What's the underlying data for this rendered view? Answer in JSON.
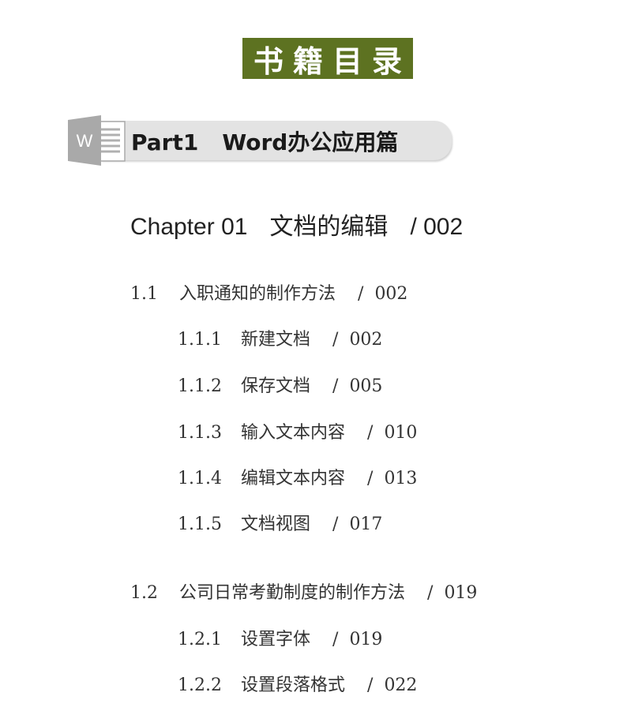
{
  "title": "书籍目录",
  "part": {
    "icon": "word-icon",
    "icon_letter": "W",
    "label": "Part1",
    "name": "Word办公应用篇"
  },
  "chapter": {
    "label": "Chapter 01",
    "title": "文档的编辑",
    "separator": "/",
    "page": "002"
  },
  "sections": [
    {
      "num": "1.1",
      "title": "入职通知的制作方法",
      "separator": "/",
      "page": "002",
      "subsections": [
        {
          "num": "1.1.1",
          "title": "新建文档",
          "separator": "/",
          "page": "002"
        },
        {
          "num": "1.1.2",
          "title": "保存文档",
          "separator": "/",
          "page": "005"
        },
        {
          "num": "1.1.3",
          "title": "输入文本内容",
          "separator": "/",
          "page": "010"
        },
        {
          "num": "1.1.4",
          "title": "编辑文本内容",
          "separator": "/",
          "page": "013"
        },
        {
          "num": "1.1.5",
          "title": "文档视图",
          "separator": "/",
          "page": "017"
        }
      ]
    },
    {
      "num": "1.2",
      "title": "公司日常考勤制度的制作方法",
      "separator": "/",
      "page": "019",
      "subsections": [
        {
          "num": "1.2.1",
          "title": "设置字体",
          "separator": "/",
          "page": "019"
        },
        {
          "num": "1.2.2",
          "title": "设置段落格式",
          "separator": "/",
          "page": "022"
        }
      ]
    }
  ],
  "colors": {
    "banner_green": "#5d7221",
    "pill_gray": "#e3e3e3",
    "icon_gray": "#a9a9a9"
  }
}
